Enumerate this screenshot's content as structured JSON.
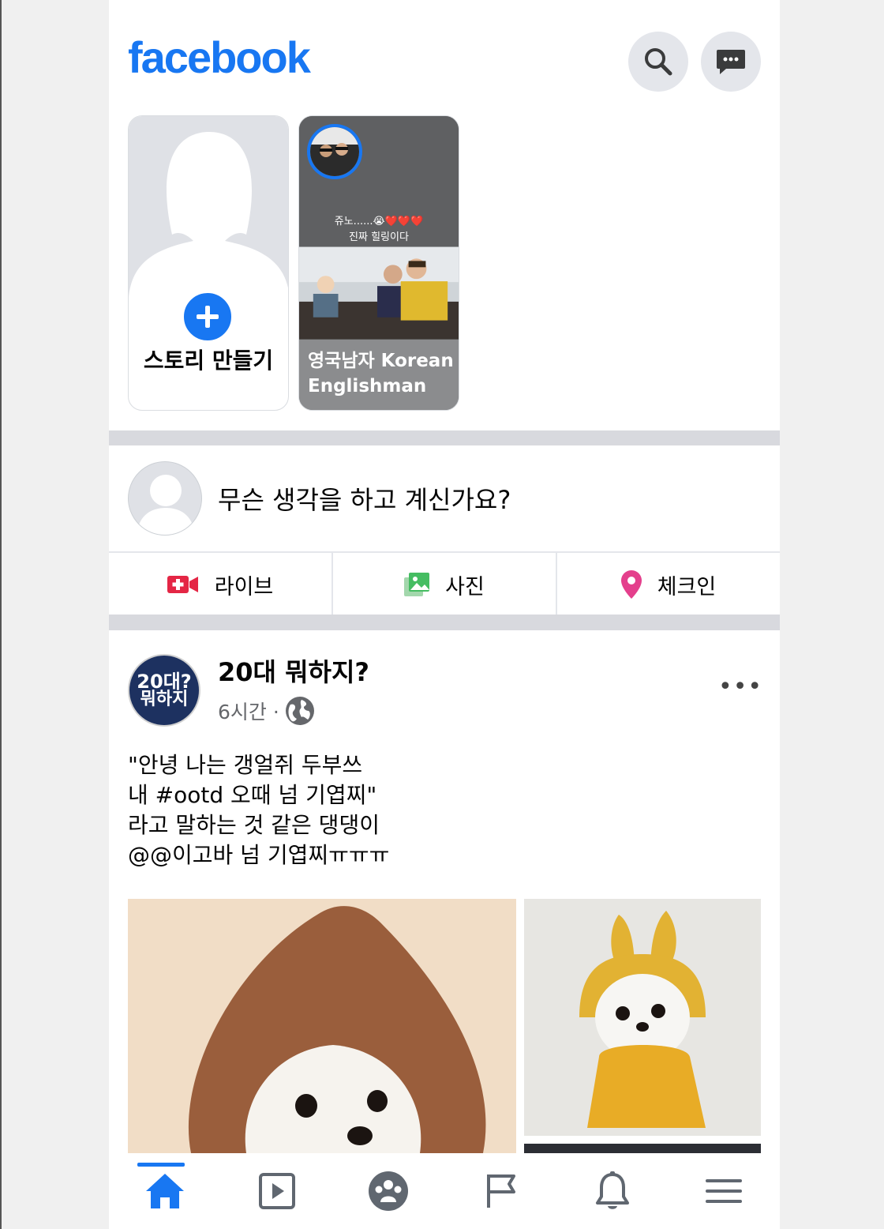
{
  "app": {
    "logo": "facebook",
    "accent_color": "#1877f2"
  },
  "header": {
    "icons": [
      "search-icon",
      "messenger-icon"
    ]
  },
  "stories": {
    "create_label": "스토리 만들기",
    "user_story": {
      "name": "영국남자 Korean Englishman",
      "caption_line1": "쥬노......😭❤️❤️❤️",
      "caption_line2": "진짜 힐링이다"
    }
  },
  "composer": {
    "placeholder": "무슨 생각을 하고 계신가요?",
    "actions": [
      {
        "label": "라이브",
        "icon": "live-video-icon",
        "color": "#e42645"
      },
      {
        "label": "사진",
        "icon": "photo-icon",
        "color": "#45bd62"
      },
      {
        "label": "체크인",
        "icon": "location-pin-icon",
        "color": "#e43f8c"
      }
    ]
  },
  "post": {
    "page_name": "20대 뭐하지?",
    "avatar_text_1": "20대?",
    "avatar_text_2": "뭐하지",
    "time": "6시간 ·",
    "audience_icon": "globe-icon",
    "more": "•••",
    "text_lines": [
      "\"안녕 나는 갱얼쥐 두부쓰",
      "내 #ootd 오때 넘 기엽찌\"",
      "라고 말하는 것 같은 댕댕이",
      "@@이고바 넘 기엽찌ㅠㅠㅠ"
    ]
  },
  "bottom_nav": {
    "items": [
      "home-icon",
      "watch-icon",
      "groups-icon",
      "pages-icon",
      "notifications-icon",
      "menu-icon"
    ],
    "active": "home-icon"
  }
}
